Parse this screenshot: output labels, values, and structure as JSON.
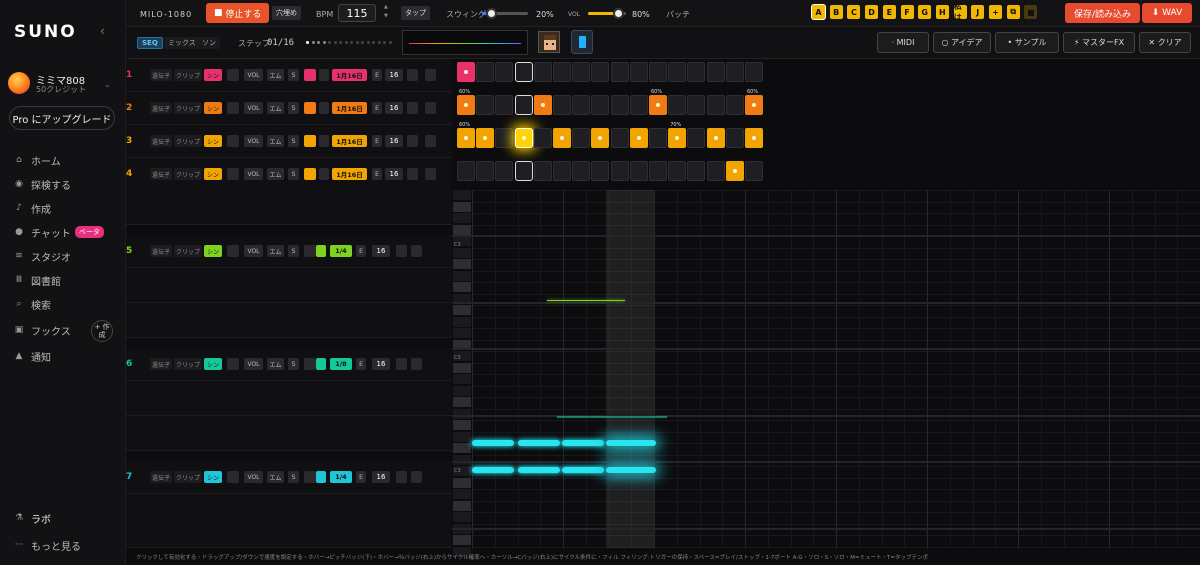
{
  "sidebar": {
    "logo": "SUNO",
    "collapse_icon": "‹",
    "user": {
      "name": "ミミマ808",
      "credits": "50クレジット"
    },
    "upgrade": "Pro にアップグレード",
    "nav": [
      {
        "icon": "home-icon",
        "glyph": "⌂",
        "label": "ホーム"
      },
      {
        "icon": "explore-icon",
        "glyph": "◉",
        "label": "探検する"
      },
      {
        "icon": "music-note-icon",
        "glyph": "♪",
        "label": "作成"
      },
      {
        "icon": "chat-icon",
        "glyph": "●",
        "label": "チャット",
        "badge": "ベータ"
      },
      {
        "icon": "studio-icon",
        "glyph": "≋",
        "label": "スタジオ"
      },
      {
        "icon": "library-icon",
        "glyph": "Ⅲ",
        "label": "図書館"
      },
      {
        "icon": "search-icon",
        "glyph": "⌕",
        "label": "検索"
      },
      {
        "icon": "hooks-icon",
        "glyph": "▣",
        "label": "フックス"
      },
      {
        "icon": "bell-icon",
        "glyph": "▲",
        "label": "通知"
      }
    ],
    "create_button": "+ 作成",
    "labs": "ラボ",
    "more": "もっと見る"
  },
  "topbar": {
    "project": "MILO-1080",
    "stop": "停止する",
    "fill": "穴埋め",
    "bpm_label": "BPM",
    "bpm": "115",
    "tap": "タップ",
    "swing_label": "スウィング",
    "swing": "20%",
    "swing_value": 0.2,
    "vol_label": "VOL",
    "vol": "80%",
    "vol_value": 0.8,
    "patch_label": "パッチ",
    "patches": [
      "A",
      "B",
      "C",
      "D",
      "E",
      "F",
      "G",
      "H",
      "私は",
      "J",
      "+",
      "⧉",
      "■"
    ],
    "save": "保存/読み込み",
    "wav": "WAV"
  },
  "toolbar": {
    "modes": [
      "SEQ",
      "ミックス",
      "ソン"
    ],
    "step_label": "ステップ",
    "step": "01/16",
    "midi": "· MIDI",
    "ideas": "○ アイデア",
    "sample": "• サンプル",
    "masterfx": "⚡ マスターFX",
    "clear": "✕ クリア"
  },
  "tracks": [
    {
      "num": "1",
      "type": "シン",
      "color": "#e8316a",
      "len": "1月16日",
      "steps": "16"
    },
    {
      "num": "2",
      "type": "シン",
      "color": "#f07a14",
      "len": "1月16日",
      "steps": "16"
    },
    {
      "num": "3",
      "type": "シン",
      "color": "#f2a500",
      "len": "1月16日",
      "steps": "16"
    },
    {
      "num": "4",
      "type": "シン",
      "color": "#f2a500",
      "len": "1月16日",
      "steps": "16"
    },
    {
      "num": "5",
      "type": "シン",
      "color": "#7ed321",
      "len": "1/4",
      "steps": "16"
    },
    {
      "num": "6",
      "type": "シン",
      "color": "#16c79a",
      "len": "1/8",
      "steps": "16"
    },
    {
      "num": "7",
      "type": "シン",
      "color": "#1ec6d6",
      "len": "1/4",
      "steps": "16"
    }
  ],
  "track_controls": {
    "a": "遺伝子",
    "b": "クリップ",
    "vol": "VOL",
    "em": "エム",
    "s": "S",
    "e": "E"
  },
  "step_labels": {
    "pct": "60%",
    "pct2": "70%"
  },
  "hint": "クリックして有効化する・ドラッグアップ/ダウンで速度を設定する・ホバー→ピッチバッジ(下)・ホバー→％バッジ(右上)からサイクル確率へ・カーソル→Cバッジ(右上)にサイクル条件に・フィル フィリング:トリガーの保持・スペース=プレイ/ストップ・1-7ボート A-G・ソロ・S・ソロ・M=ミュート・T=タップテンポ",
  "c3": "C3"
}
